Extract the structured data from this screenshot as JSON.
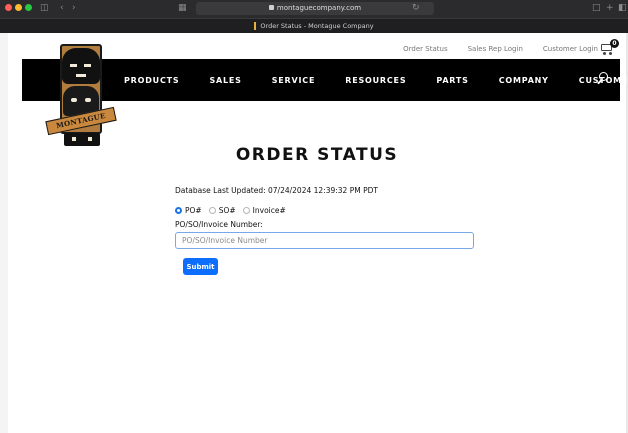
{
  "browser": {
    "url": "montaguecompany.com",
    "tab_title": "Order Status - Montague Company",
    "colors": {
      "close": "#ff5f57",
      "minimize": "#febc2e",
      "zoom": "#28c840"
    }
  },
  "header": {
    "utility_links": [
      "Order Status",
      "Sales Rep Login",
      "Customer Login"
    ],
    "cart_count": "0",
    "nav_items": [
      "PRODUCTS",
      "SALES",
      "SERVICE",
      "RESOURCES",
      "PARTS",
      "COMPANY",
      "CUSTOMERS"
    ]
  },
  "logo": {
    "ribbon_text": "MONTAGUE"
  },
  "main": {
    "title": "ORDER STATUS",
    "last_updated": "Database Last Updated: 07/24/2024 12:39:32 PM PDT",
    "radio_options": [
      {
        "label": "PO#",
        "checked": true
      },
      {
        "label": "SO#",
        "checked": false
      },
      {
        "label": "Invoice#",
        "checked": false
      }
    ],
    "field_label": "PO/SO/Invoice Number:",
    "input_placeholder": "PO/SO/Invoice Number",
    "input_value": "",
    "submit_label": "Submit"
  },
  "colors": {
    "accent": "#0d6efd",
    "nav_background": "#000000",
    "logo_gold": "#b07d3e"
  }
}
